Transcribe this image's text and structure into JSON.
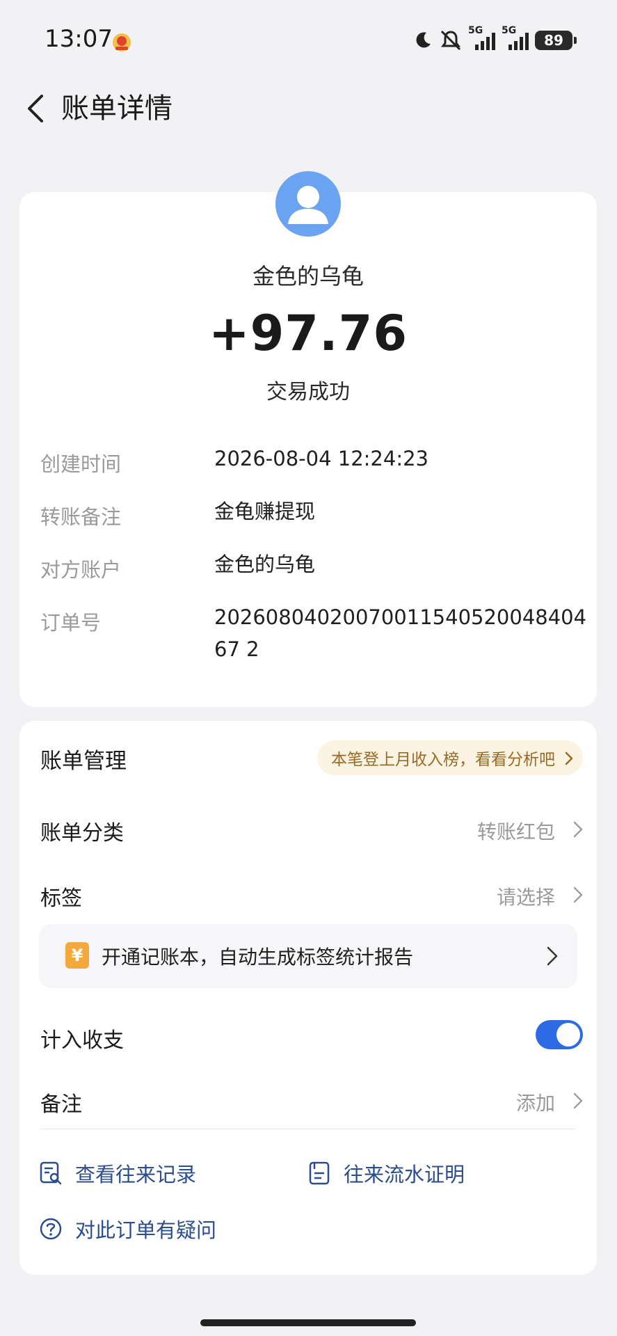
{
  "status_bar": {
    "time": "13:07",
    "signal_1": "5G",
    "signal_2": "5G",
    "battery": "89"
  },
  "nav": {
    "title": "账单详情"
  },
  "summary": {
    "payee": "金色的乌龟",
    "amount": "+97.76",
    "status": "交易成功"
  },
  "details": [
    {
      "label": "创建时间",
      "value": "2026-08-04 12:24:23"
    },
    {
      "label": "转账备注",
      "value": "金龟赚提现"
    },
    {
      "label": "对方账户",
      "value": "金色的乌龟"
    },
    {
      "label": "订单号",
      "value": "2026080402007001154052004840467 2"
    }
  ],
  "management": {
    "title": "账单管理",
    "promo": "本笔登上月收入榜，看看分析吧",
    "category_label": "账单分类",
    "category_value": "转账红包",
    "tag_label": "标签",
    "tag_value": "请选择",
    "banner_icon": "¥",
    "banner_text": "开通记账本，自动生成标签统计报告",
    "include_label": "计入收支",
    "include_enabled": true,
    "note_label": "备注",
    "note_value": "添加"
  },
  "links": {
    "history": "查看往来记录",
    "statement": "往来流水证明",
    "question": "对此订单有疑问"
  },
  "colors": {
    "accent": "#2f6ae5",
    "link": "#2b4d8c",
    "avatar": "#6aa3f1",
    "promo_bg": "#fcf4e3",
    "promo_text": "#9a6a24"
  }
}
